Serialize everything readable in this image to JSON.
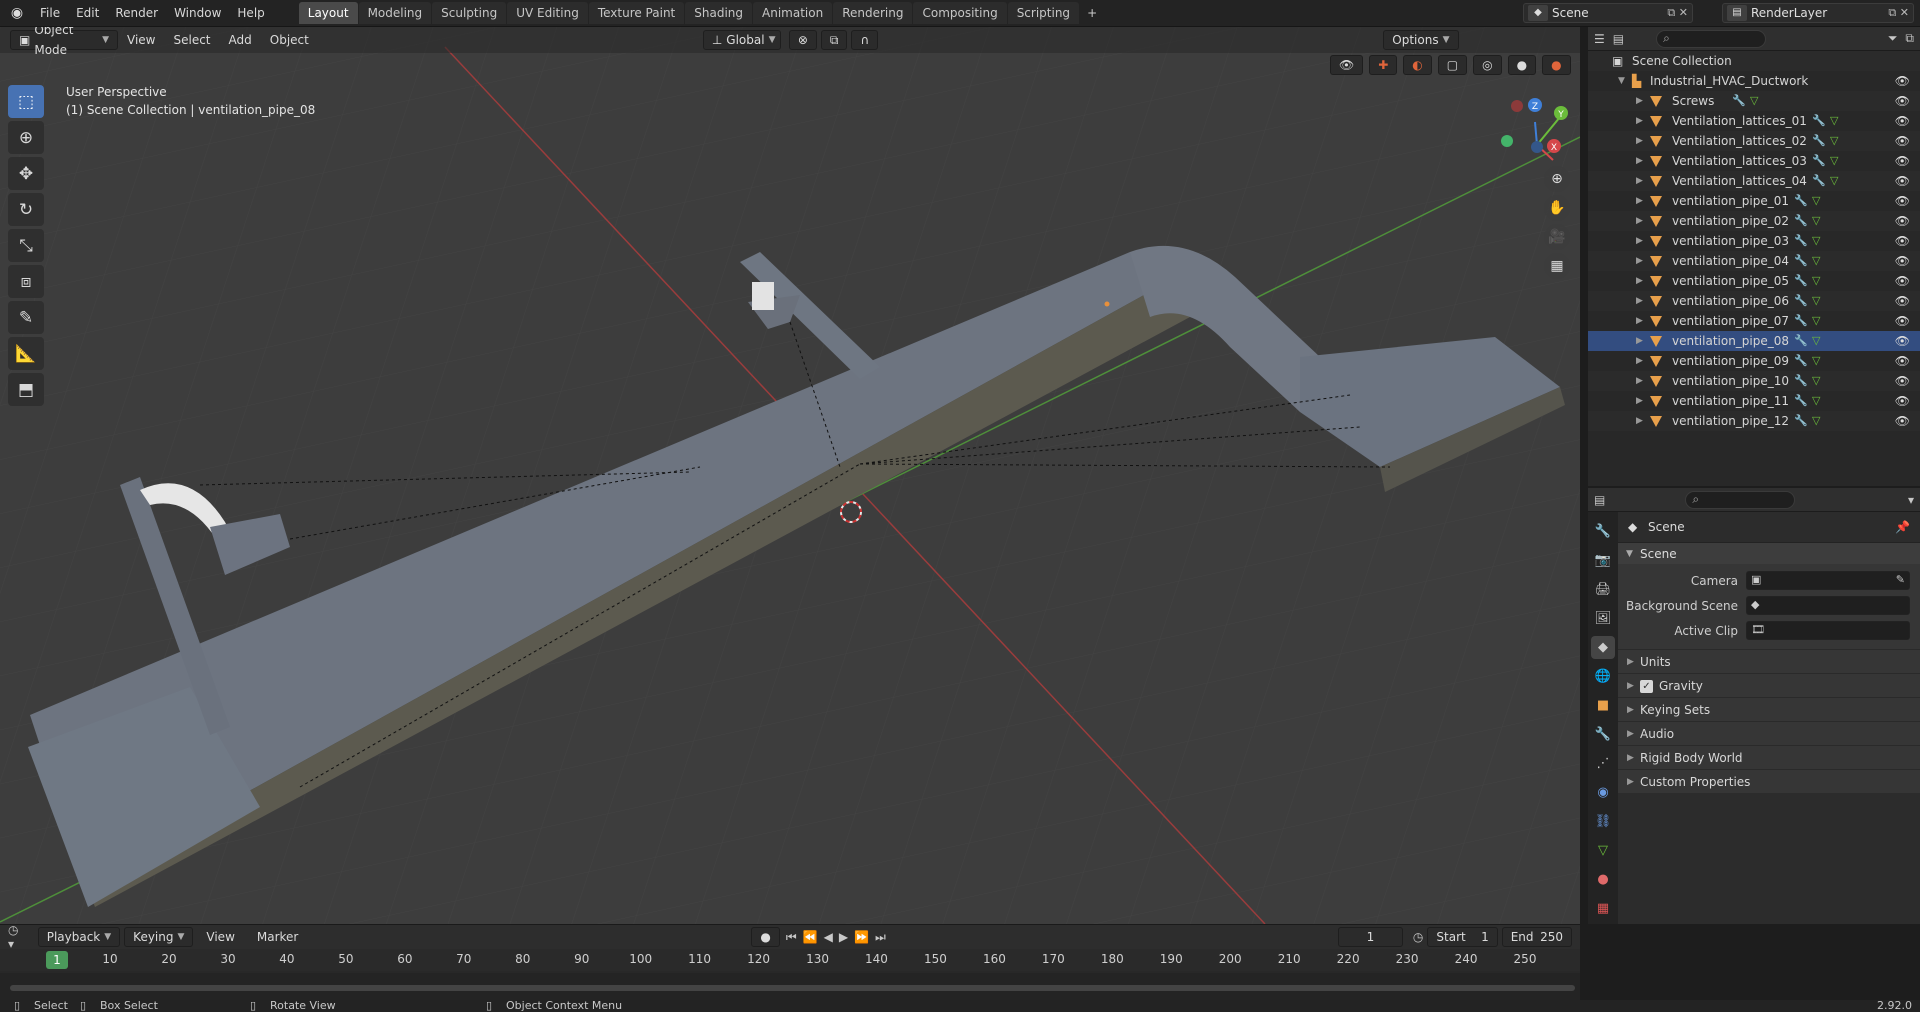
{
  "topbar": {
    "menus": [
      "File",
      "Edit",
      "Render",
      "Window",
      "Help"
    ],
    "workspaces": [
      "Layout",
      "Modeling",
      "Sculpting",
      "UV Editing",
      "Texture Paint",
      "Shading",
      "Animation",
      "Rendering",
      "Compositing",
      "Scripting"
    ],
    "active_workspace": "Layout",
    "add_tab": "+",
    "scene_name": "Scene",
    "view_layer": "RenderLayer"
  },
  "viewport": {
    "mode": "Object Mode",
    "menus": [
      "View",
      "Select",
      "Add",
      "Object"
    ],
    "orientation": "Global",
    "options_label": "Options",
    "info_line1": "User Perspective",
    "info_line2": "(1) Scene Collection | ventilation_pipe_08",
    "gizmo_labels": {
      "z": "Z",
      "y": "Y",
      "x": "X"
    },
    "tools": [
      "select-box-icon",
      "cursor-icon",
      "move-icon",
      "rotate-icon",
      "scale-icon",
      "transform-icon",
      "annotate-icon",
      "measure-icon",
      "add-cube-icon"
    ],
    "nav": [
      "zoom-icon",
      "pan-icon",
      "camera-icon",
      "ortho-grid-icon"
    ]
  },
  "outliner": {
    "root": "Scene Collection",
    "collection": "Industrial_HVAC_Ductwork",
    "objects": [
      {
        "name": "Screws",
        "selected": false
      },
      {
        "name": "Ventilation_lattices_01",
        "selected": false
      },
      {
        "name": "Ventilation_lattices_02",
        "selected": false
      },
      {
        "name": "Ventilation_lattices_03",
        "selected": false
      },
      {
        "name": "Ventilation_lattices_04",
        "selected": false
      },
      {
        "name": "ventilation_pipe_01",
        "selected": false
      },
      {
        "name": "ventilation_pipe_02",
        "selected": false
      },
      {
        "name": "ventilation_pipe_03",
        "selected": false
      },
      {
        "name": "ventilation_pipe_04",
        "selected": false
      },
      {
        "name": "ventilation_pipe_05",
        "selected": false
      },
      {
        "name": "ventilation_pipe_06",
        "selected": false
      },
      {
        "name": "ventilation_pipe_07",
        "selected": false
      },
      {
        "name": "ventilation_pipe_08",
        "selected": true
      },
      {
        "name": "ventilation_pipe_09",
        "selected": false
      },
      {
        "name": "ventilation_pipe_10",
        "selected": false
      },
      {
        "name": "ventilation_pipe_11",
        "selected": false
      },
      {
        "name": "ventilation_pipe_12",
        "selected": false
      }
    ]
  },
  "properties": {
    "context_title": "Scene",
    "panel_title": "Scene",
    "fields": [
      {
        "label": "Camera",
        "value": ""
      },
      {
        "label": "Background Scene",
        "value": ""
      },
      {
        "label": "Active Clip",
        "value": ""
      }
    ],
    "subpanels": [
      "Units",
      "Gravity",
      "Keying Sets",
      "Audio",
      "Rigid Body World",
      "Custom Properties"
    ],
    "gravity_checked": true
  },
  "timeline": {
    "menus": [
      "Playback",
      "Keying",
      "View",
      "Marker"
    ],
    "current_frame": "1",
    "start_label": "Start",
    "start": "1",
    "end_label": "End",
    "end": "250",
    "ticks": [
      "1",
      "10",
      "20",
      "30",
      "40",
      "50",
      "60",
      "70",
      "80",
      "90",
      "100",
      "110",
      "120",
      "130",
      "140",
      "150",
      "160",
      "170",
      "180",
      "190",
      "200",
      "210",
      "220",
      "230",
      "240",
      "250"
    ]
  },
  "statusbar": {
    "select": "Select",
    "box_select": "Box Select",
    "rotate_view": "Rotate View",
    "context_menu": "Object Context Menu",
    "version": "2.92.0"
  },
  "colors": {
    "accent": "#4772b3",
    "object_icon": "#e8a04b",
    "x_axis": "#d5474a",
    "y_axis": "#6bbd3b",
    "z_axis": "#3f7fd8"
  }
}
